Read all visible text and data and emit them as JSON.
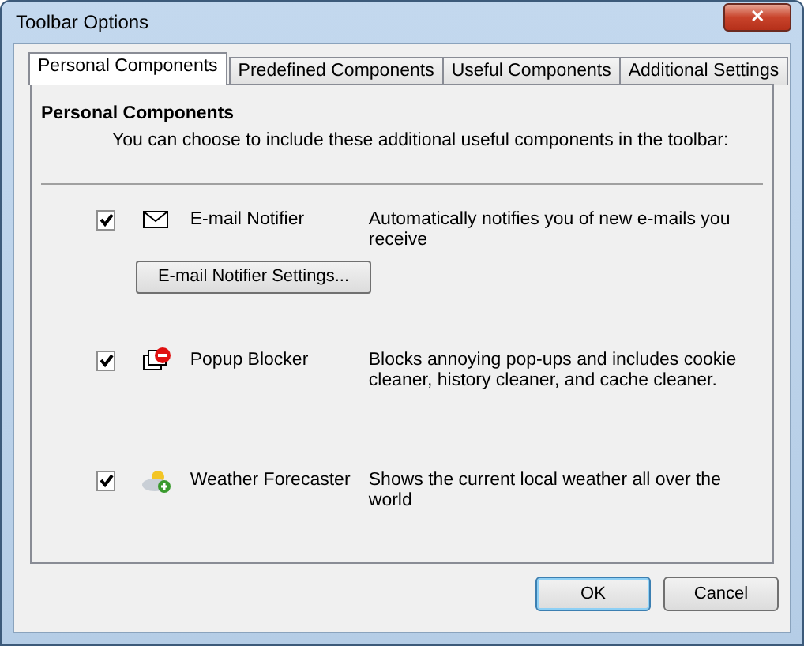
{
  "window": {
    "title": "Toolbar Options",
    "close": "✕"
  },
  "tabs": [
    {
      "label": "Personal Components",
      "selected": true
    },
    {
      "label": "Predefined Components",
      "selected": false
    },
    {
      "label": "Useful Components",
      "selected": false
    },
    {
      "label": "Additional Settings",
      "selected": false
    }
  ],
  "panel": {
    "heading": "Personal Components",
    "intro": "You can choose to include these additional useful components in the toolbar:"
  },
  "components": [
    {
      "kind": "mail",
      "name": "E-mail Notifier",
      "description": "Automatically notifies you of new e-mails you receive",
      "checked": true,
      "button": "E-mail Notifier Settings..."
    },
    {
      "kind": "blocker",
      "name": "Popup Blocker",
      "description": "Blocks annoying pop-ups and includes cookie cleaner, history cleaner, and cache cleaner.",
      "checked": true
    },
    {
      "kind": "weather",
      "name": "Weather Forecaster",
      "description": "Shows the current local weather all over the world",
      "checked": true
    }
  ],
  "buttons": [
    {
      "label": "OK",
      "default": true
    },
    {
      "label": "Cancel",
      "default": false
    }
  ]
}
